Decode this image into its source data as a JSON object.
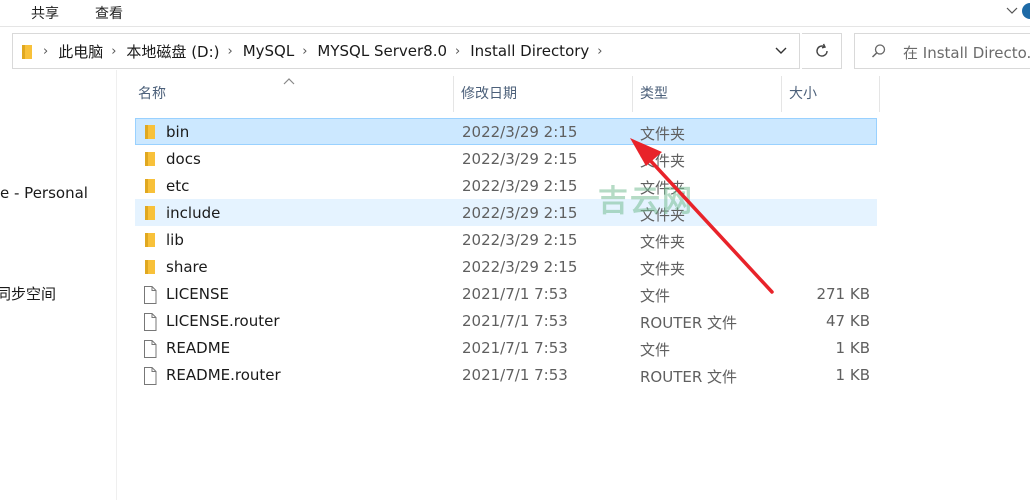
{
  "ribbon": {
    "tabs": [
      "共享",
      "查看"
    ]
  },
  "address": {
    "crumbs": [
      "此电脑",
      "本地磁盘 (D:)",
      "MySQL",
      "MYSQL Server8.0",
      "Install Directory"
    ]
  },
  "search": {
    "placeholder": "在 Install Directo..."
  },
  "nav": {
    "items": [
      "e - Personal",
      "同步空间"
    ]
  },
  "columns": {
    "name": "名称",
    "date": "修改日期",
    "type": "类型",
    "size": "大小"
  },
  "files": [
    {
      "name": "bin",
      "date": "2022/3/29 2:15",
      "type": "文件夹",
      "size": "",
      "kind": "folder"
    },
    {
      "name": "docs",
      "date": "2022/3/29 2:15",
      "type": "文件夹",
      "size": "",
      "kind": "folder"
    },
    {
      "name": "etc",
      "date": "2022/3/29 2:15",
      "type": "文件夹",
      "size": "",
      "kind": "folder"
    },
    {
      "name": "include",
      "date": "2022/3/29 2:15",
      "type": "文件夹",
      "size": "",
      "kind": "folder"
    },
    {
      "name": "lib",
      "date": "2022/3/29 2:15",
      "type": "文件夹",
      "size": "",
      "kind": "folder"
    },
    {
      "name": "share",
      "date": "2022/3/29 2:15",
      "type": "文件夹",
      "size": "",
      "kind": "folder"
    },
    {
      "name": "LICENSE",
      "date": "2021/7/1 7:53",
      "type": "文件",
      "size": "271 KB",
      "kind": "file"
    },
    {
      "name": "LICENSE.router",
      "date": "2021/7/1 7:53",
      "type": "ROUTER 文件",
      "size": "47 KB",
      "kind": "file"
    },
    {
      "name": "README",
      "date": "2021/7/1 7:53",
      "type": "文件",
      "size": "1 KB",
      "kind": "file"
    },
    {
      "name": "README.router",
      "date": "2021/7/1 7:53",
      "type": "ROUTER 文件",
      "size": "1 KB",
      "kind": "file"
    }
  ],
  "watermark": {
    "text": "吉云网"
  },
  "colors": {
    "selected_bg": "#cce8ff",
    "hover_bg": "#e5f3ff",
    "folder": "#f8c13a",
    "arrow": "#e8232a"
  }
}
